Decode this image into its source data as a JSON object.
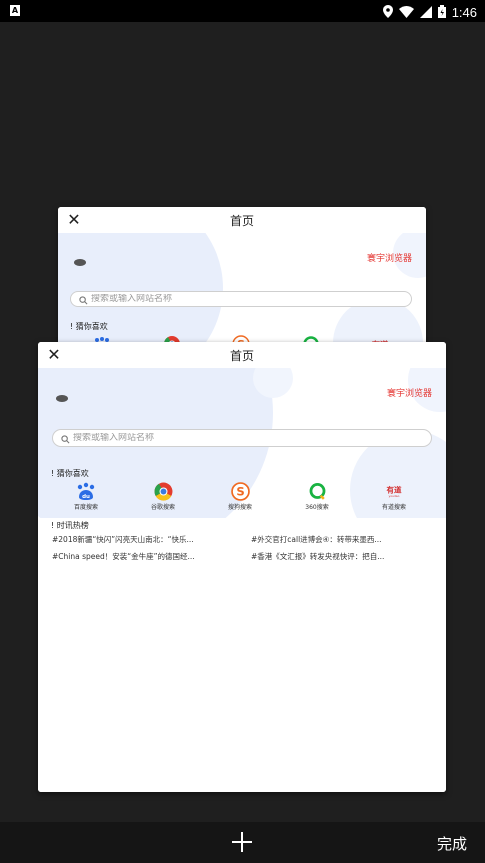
{
  "status_bar": {
    "app_badge": "A",
    "time": "1:46",
    "icons": [
      "location-icon",
      "wifi-icon",
      "signal-icon",
      "battery-icon"
    ]
  },
  "tabs": [
    {
      "title": "首页",
      "brand": "寰宇浏览器",
      "search_placeholder": "搜索或输入网站名称",
      "section_like": "! 猜你喜欢"
    },
    {
      "title": "首页",
      "brand": "寰宇浏览器",
      "search_placeholder": "搜索或输入网站名称",
      "section_like": "! 猜你喜欢",
      "shortcuts": [
        {
          "label": "百度搜索",
          "icon": "baidu-icon"
        },
        {
          "label": "谷歌搜索",
          "icon": "chrome-icon"
        },
        {
          "label": "搜狗搜索",
          "icon": "sogou-icon"
        },
        {
          "label": "360搜索",
          "icon": "360-icon"
        },
        {
          "label": "有道搜索",
          "icon": "youdao-icon"
        }
      ],
      "section_news": "! 时讯热榜",
      "news": [
        "#2018新疆“快闪”闪亮天山南北：“快乐...",
        "#外交官打call进博会④：转带来墨西...",
        "#China speed！安装“金牛座”的德国经...",
        "#香港《文汇报》转发央视快评：把自..."
      ]
    }
  ],
  "bottom_bar": {
    "add_icon": "plus-icon",
    "done_label": "完成"
  },
  "colors": {
    "background": "#1f1f1f",
    "accent_red": "#e53935",
    "art_blue": "#e8eefb"
  }
}
